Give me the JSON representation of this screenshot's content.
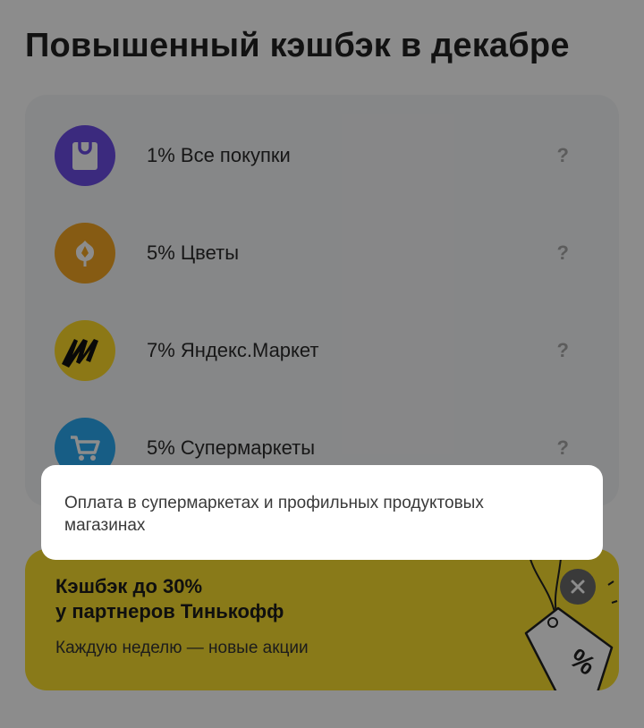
{
  "page": {
    "title": "Повышенный кэшбэк в декабре"
  },
  "cashback_list": {
    "items": [
      {
        "label": "1% Все покупки",
        "help": "?",
        "icon": "shopping-bag-icon",
        "color": "#6c4de6"
      },
      {
        "label": "5% Цветы",
        "help": "?",
        "icon": "flower-icon",
        "color": "#f5a623"
      },
      {
        "label": "7% Яндекс.Маркет",
        "help": "?",
        "icon": "yandex-market-icon",
        "color": "#ffdb28"
      },
      {
        "label": "5% Супермаркеты",
        "help": "?",
        "icon": "cart-icon",
        "color": "#2aa9f2"
      }
    ]
  },
  "promo": {
    "title_line1": "Кэшбэк до 30%",
    "title_line2": "у партнеров Тинькофф",
    "subtitle": "Каждую неделю — новые акции",
    "tag_text": "%",
    "background": "#f9df2e"
  },
  "tooltip": {
    "text": "Оплата в супермаркетах и профильных продуктовых магазинах"
  }
}
